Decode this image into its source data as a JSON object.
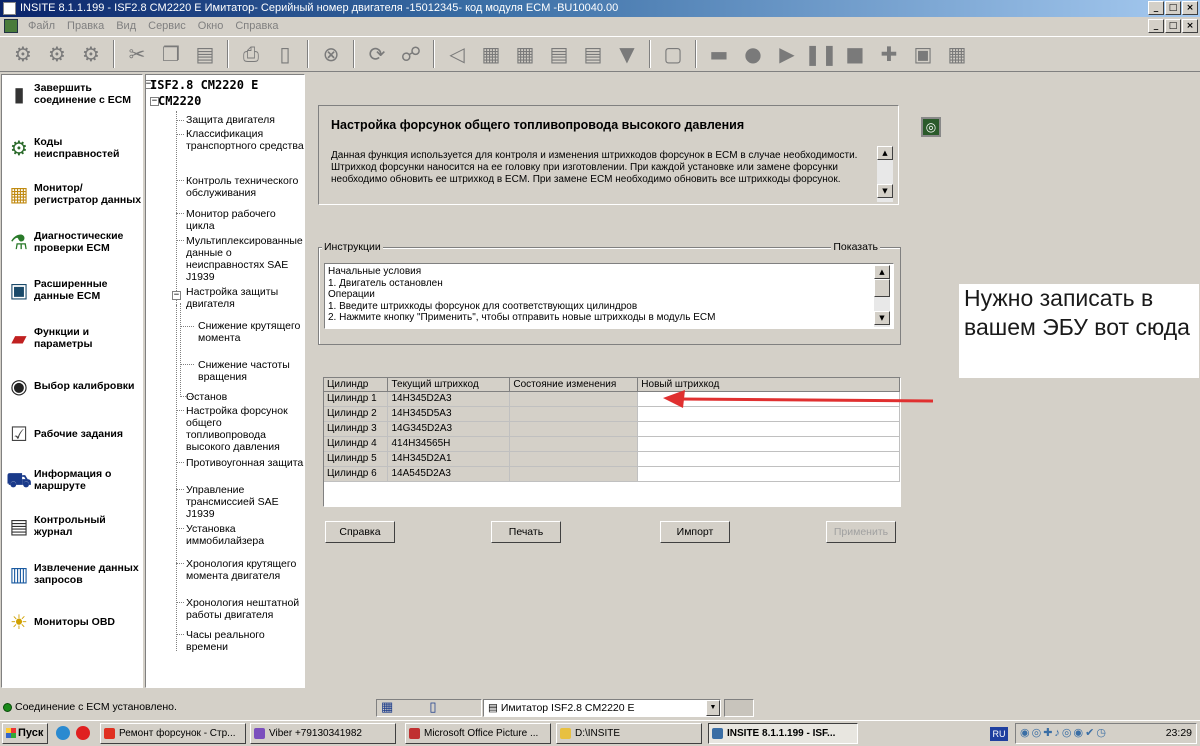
{
  "window": {
    "title": "INSITE 8.1.1.199  - ISF2.8 CM2220 E Имитатор- Серийный номер двигателя -15012345- код модуля ECM -BU10040.00",
    "controls": [
      "_",
      "□",
      "×"
    ]
  },
  "menu": [
    "Файл",
    "Правка",
    "Вид",
    "Сервис",
    "Окно",
    "Справка"
  ],
  "toolbar": {
    "icons": [
      "connect-icon",
      "disconnect-icon",
      "ecm-icon",
      "cut-icon",
      "copy-icon",
      "paste-icon",
      "print-icon",
      "print-preview-icon",
      "find-icon",
      "refresh-icon",
      "properties-icon",
      "signal-icon",
      "database-icon",
      "database-edit-icon",
      "report-icon",
      "report-edit-icon",
      "filter-icon",
      "window-icon",
      "connector-icon",
      "stop-circle-icon",
      "play-icon",
      "pause-icon",
      "stop-icon",
      "add-icon",
      "tools-icon",
      "calc-icon"
    ]
  },
  "sidebar": {
    "items": [
      {
        "label": "Завершить соединение с ECM",
        "icon": "disconnect-icon"
      },
      {
        "label": "Коды неисправностей",
        "icon": "fault-codes-icon"
      },
      {
        "label": "Монитор/регистратор данных",
        "icon": "monitor-icon"
      },
      {
        "label": "Диагностические проверки ECM",
        "icon": "flask-icon"
      },
      {
        "label": "Расширенные данные ECM",
        "icon": "ecm-data-icon"
      },
      {
        "label": "Функции и параметры",
        "icon": "toolbox-icon"
      },
      {
        "label": "Выбор калибровки",
        "icon": "disc-icon"
      },
      {
        "label": "Рабочие задания",
        "icon": "checklist-icon"
      },
      {
        "label": "Информация о маршруте",
        "icon": "truck-icon"
      },
      {
        "label": "Контрольный журнал",
        "icon": "journal-icon"
      },
      {
        "label": "Извлечение данных запросов",
        "icon": "extract-icon"
      },
      {
        "label": "Мониторы OBD",
        "icon": "obd-icon"
      }
    ]
  },
  "tree": {
    "root": "ISF2.8 CM2220 E",
    "module": "CM2220",
    "root_toggle": "−",
    "module_toggle": "−",
    "nodes": [
      "Защита двигателя",
      "Классификация транспортного средства",
      "Контроль технического обслуживания",
      "Монитор рабочего цикла",
      "Мультиплексированные данные о неисправностях SAE J1939",
      "Настройка защиты двигателя",
      "Снижение крутящего момента",
      "Снижение частоты вращения",
      "Останов",
      "Настройка форсунок общего топливопровода высокого давления",
      "Противоугонная защита",
      "Управление трансмиссией SAE J1939",
      "Установка иммобилайзера",
      "Хронология крутящего момента двигателя",
      "Хронология нештатной работы двигателя",
      "Часы реального времени"
    ]
  },
  "main": {
    "title": "Настройка форсунок общего топливопровода высокого давления",
    "description": "Данная функция используется для контроля и изменения штрихкодов форсунок в ECM в случае необходимости. Штрихкод форсунки наносится на ее головку при изготовлении. При каждой установке или замене форсунки необходимо обновить ее штрихкод в ECM. При замене ECM необходимо обновить все штрихкоды форсунок.",
    "instructions_label": "Инструкции",
    "show_label": "Показать",
    "instructions": [
      "Начальные условия",
      "1.     Двигатель остановлен",
      "Операции",
      "1.     Введите штрихкоды форсунок для соответствующих цилиндров",
      "2.     Нажмите кнопку \"Применить\", чтобы отправить новые штрихкоды в модуль ECM"
    ],
    "table": {
      "headers": [
        "Цилиндр",
        "Текущий штрихкод",
        "Состояние изменения",
        "Новый штрихкод"
      ],
      "rows": [
        [
          "Цилиндр 1",
          "14H345D2A3",
          "",
          ""
        ],
        [
          "Цилиндр 2",
          "14H345D5A3",
          "",
          ""
        ],
        [
          "Цилиндр 3",
          "14G345D2A3",
          "",
          ""
        ],
        [
          "Цилиндр 4",
          "414H34565H",
          "",
          ""
        ],
        [
          "Цилиндр 5",
          "14H345D2A1",
          "",
          ""
        ],
        [
          "Цилиндр 6",
          "14A545D2A3",
          "",
          ""
        ]
      ]
    },
    "buttons": {
      "help": "Справка",
      "print": "Печать",
      "import": "Импорт",
      "apply": "Применить"
    },
    "annotation": "Нужно записать в вашем ЭБУ вот сюда",
    "annotation_color": "#e03030"
  },
  "status": {
    "connection": "Соединение с ECM установлено.",
    "simulator": "Имитатор ISF2.8 CM2220 E"
  },
  "taskbar": {
    "start": "Пуск",
    "tasks": [
      {
        "label": "Ремонт форсунок - Стр...",
        "color": "#e03020"
      },
      {
        "label": "Viber +79130341982",
        "color": "#7b4fbd"
      },
      {
        "label": "Microsoft Office Picture ...",
        "color": "#c03030"
      },
      {
        "label": "D:\\INSITE",
        "color": "#e8c040"
      },
      {
        "label": "INSITE 8.1.1.199 - ISF...",
        "color": "#3a6ea5"
      }
    ],
    "lang": "RU",
    "clock": "23:29"
  }
}
